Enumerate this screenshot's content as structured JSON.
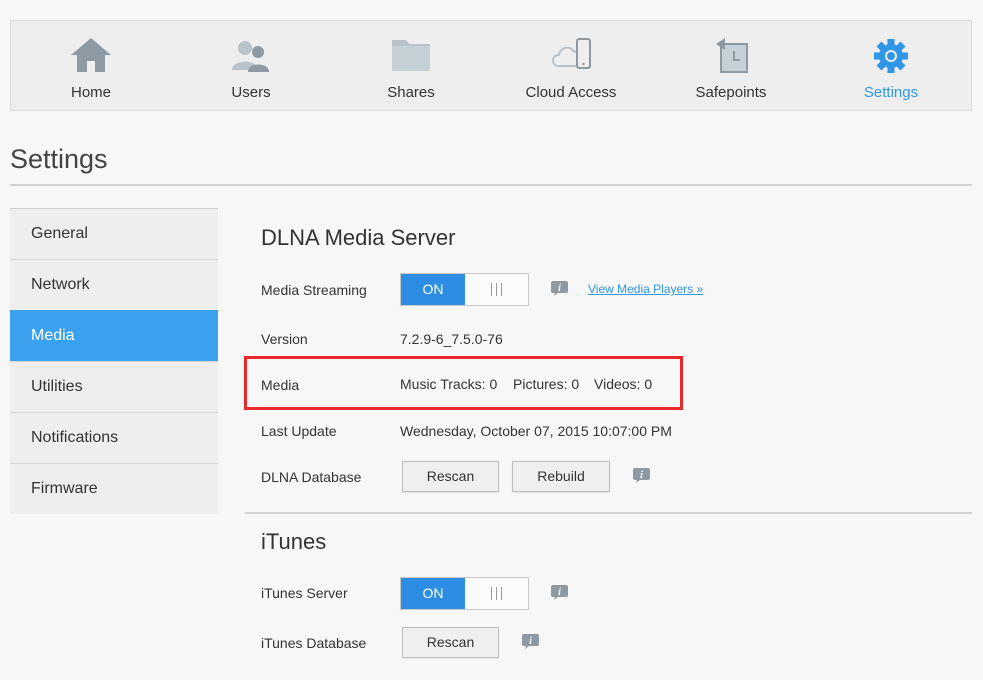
{
  "nav": {
    "items": [
      {
        "label": "Home",
        "icon": "home-icon"
      },
      {
        "label": "Users",
        "icon": "users-icon"
      },
      {
        "label": "Shares",
        "icon": "folder-icon"
      },
      {
        "label": "Cloud Access",
        "icon": "cloud-device-icon"
      },
      {
        "label": "Safepoints",
        "icon": "safepoint-icon"
      },
      {
        "label": "Settings",
        "icon": "gear-icon"
      }
    ],
    "active": "Settings",
    "accent_color": "#2f96e8"
  },
  "page": {
    "title": "Settings"
  },
  "sidebar": {
    "items": [
      {
        "label": "General"
      },
      {
        "label": "Network"
      },
      {
        "label": "Media"
      },
      {
        "label": "Utilities"
      },
      {
        "label": "Notifications"
      },
      {
        "label": "Firmware"
      }
    ],
    "active": "Media",
    "active_color": "#3aa1f1"
  },
  "dlna": {
    "title": "DLNA Media Server",
    "streaming_label": "Media Streaming",
    "streaming_state": "ON",
    "view_players_link": "View Media Players »",
    "version_label": "Version",
    "version_value": "7.2.9-6_7.5.0-76",
    "media_label": "Media",
    "music_tracks": "Music Tracks: 0",
    "pictures": "Pictures: 0",
    "videos": "Videos: 0",
    "last_update_label": "Last Update",
    "last_update_value": "Wednesday, October 07, 2015 10:07:00 PM",
    "database_label": "DLNA Database",
    "rescan_label": "Rescan",
    "rebuild_label": "Rebuild"
  },
  "itunes": {
    "title": "iTunes",
    "server_label": "iTunes Server",
    "server_state": "ON",
    "database_label": "iTunes Database",
    "rescan_label": "Rescan"
  },
  "highlight_color": "#e8282a"
}
